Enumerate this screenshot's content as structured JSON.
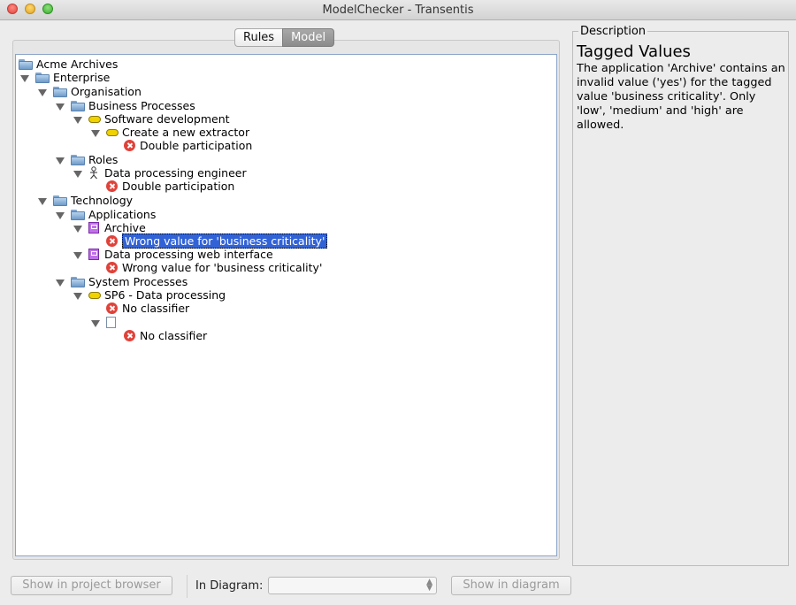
{
  "window": {
    "title": "ModelChecker - Transentis"
  },
  "tabs": [
    {
      "label": "Rules"
    },
    {
      "label": "Model"
    }
  ],
  "tree": [
    {
      "label": "Acme Archives",
      "icon": "folder-icon"
    },
    {
      "label": "Enterprise",
      "icon": "folder-icon"
    },
    {
      "label": "Organisation",
      "icon": "folder-icon"
    },
    {
      "label": "Business Processes",
      "icon": "folder-icon"
    },
    {
      "label": "Software development",
      "icon": "process-icon"
    },
    {
      "label": "Create a new extractor",
      "icon": "process-icon"
    },
    {
      "label": "Double participation",
      "icon": "error-icon"
    },
    {
      "label": "Roles",
      "icon": "folder-icon"
    },
    {
      "label": "Data processing engineer",
      "icon": "actor-icon"
    },
    {
      "label": "Double participation",
      "icon": "error-icon"
    },
    {
      "label": "Technology",
      "icon": "folder-icon"
    },
    {
      "label": "Applications",
      "icon": "folder-icon"
    },
    {
      "label": "Archive",
      "icon": "application-icon"
    },
    {
      "label": "Wrong value for 'business criticality'",
      "icon": "error-icon",
      "selected": true
    },
    {
      "label": "Data processing web interface",
      "icon": "application-icon"
    },
    {
      "label": "Wrong value for 'business criticality'",
      "icon": "error-icon"
    },
    {
      "label": "System Processes",
      "icon": "folder-icon"
    },
    {
      "label": "SP6 - Data processing",
      "icon": "process-icon"
    },
    {
      "label": "No classifier",
      "icon": "error-icon"
    },
    {
      "label": "",
      "icon": "document-icon"
    },
    {
      "label": "No classifier",
      "icon": "error-icon"
    }
  ],
  "description": {
    "legend": "Description",
    "title": "Tagged Values",
    "text": "The application 'Archive' contains an invalid value ('yes') for the tagged value 'business criticality'. Only 'low', 'medium' and 'high' are allowed."
  },
  "bottom": {
    "show_in_project_browser": "Show in project browser",
    "in_diagram_label": "In Diagram:",
    "diagram_select_value": "",
    "show_in_diagram": "Show in diagram"
  }
}
